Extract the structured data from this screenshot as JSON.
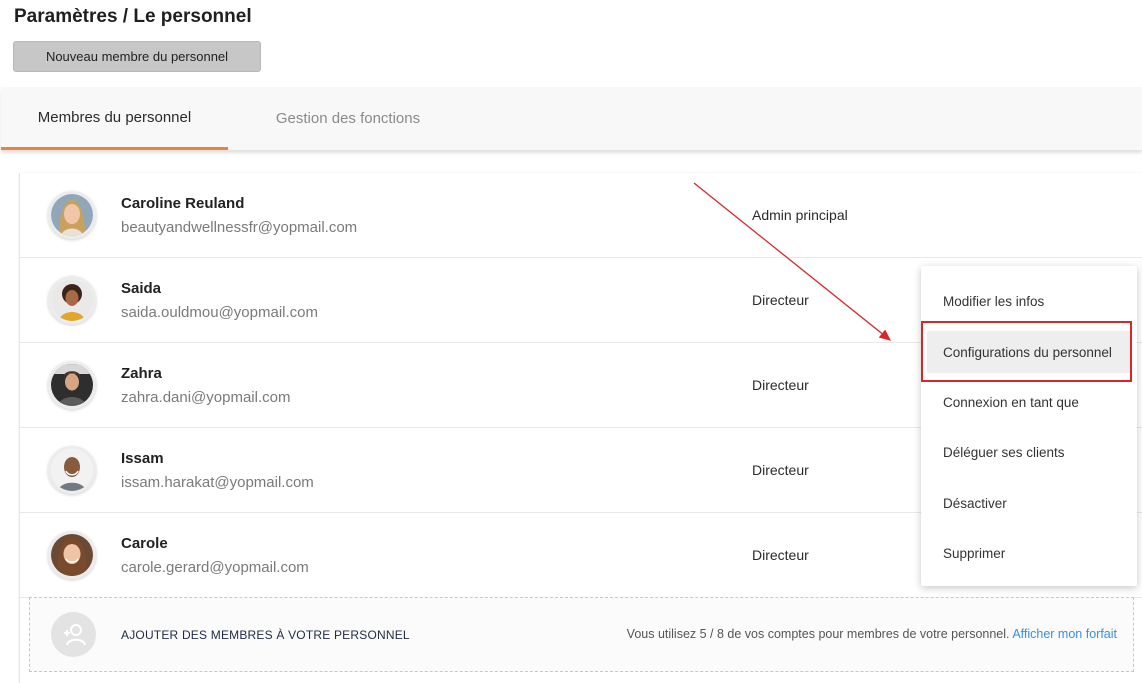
{
  "header": {
    "title": "Paramètres / Le personnel",
    "new_member_label": "Nouveau membre du personnel"
  },
  "tabs": [
    {
      "label": "Membres du personnel",
      "active": true
    },
    {
      "label": "Gestion des fonctions",
      "active": false
    }
  ],
  "staff": [
    {
      "name": "Caroline Reuland",
      "email": "beautyandwellnessfr@yopmail.com",
      "role": "Admin principal"
    },
    {
      "name": "Saida",
      "email": "saida.ouldmou@yopmail.com",
      "role": "Directeur"
    },
    {
      "name": "Zahra",
      "email": "zahra.dani@yopmail.com",
      "role": "Directeur"
    },
    {
      "name": "Issam",
      "email": "issam.harakat@yopmail.com",
      "role": "Directeur"
    },
    {
      "name": "Carole",
      "email": "carole.gerard@yopmail.com",
      "role": "Directeur"
    }
  ],
  "add_members": {
    "label": "AJOUTER DES MEMBRES À VOTRE PERSONNEL",
    "usage_text": "Vous utilisez 5 / 8 de vos comptes pour membres de votre personnel.",
    "link_text": "Afficher mon forfait"
  },
  "context_menu": {
    "items": [
      "Modifier les infos",
      "Configurations du personnel",
      "Connexion en tant que",
      "Déléguer ses clients",
      "Désactiver",
      "Supprimer"
    ],
    "highlighted": "Configurations du personnel"
  },
  "colors": {
    "accent_tab": "#e8833a",
    "annotation": "#d9262b",
    "link": "#3a8fd8"
  }
}
